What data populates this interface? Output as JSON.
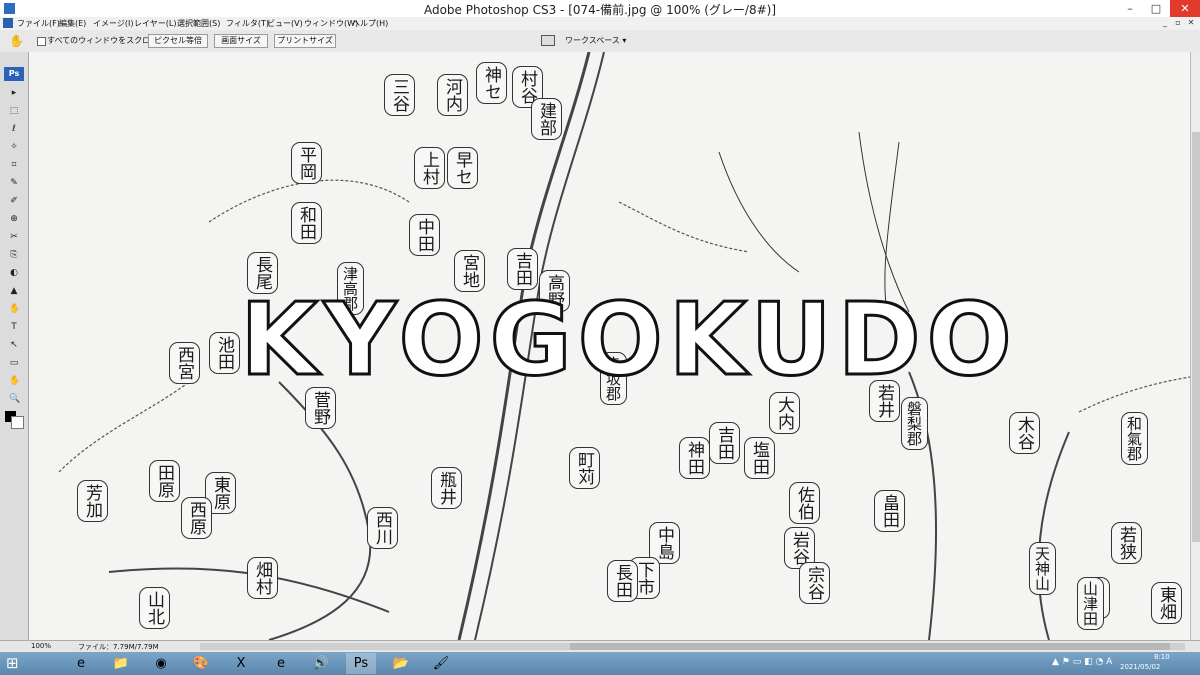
{
  "window": {
    "title": "Adobe Photoshop CS3 - [074-備前.jpg @ 100% (グレー/8#)]",
    "controls": {
      "minimize": "–",
      "maximize": "□",
      "close": "✕"
    }
  },
  "menu": {
    "items": [
      "ファイル(F)",
      "編集(E)",
      "イメージ(I)",
      "レイヤー(L)",
      "選択範囲(S)",
      "フィルタ(T)",
      "ビュー(V)",
      "ウィンドウ(W)",
      "ヘルプ(H)"
    ],
    "doc_controls": {
      "minimize": "_",
      "restore": "▫",
      "close": "✕"
    }
  },
  "options_bar": {
    "tool_icon": "hand-tool-icon",
    "scroll_all_windows_label": "すべてのウィンドウをスクロール",
    "scroll_all_windows_checked": false,
    "buttons": [
      "ピクセル等倍",
      "画面サイズ",
      "プリントサイズ"
    ],
    "workspace_label": "ワークスペース ▾"
  },
  "toolbox": {
    "logo": "Ps",
    "tool_glyphs": [
      "▸",
      "⬚",
      "ℓ",
      "✧",
      "⌗",
      "✎",
      "✐",
      "⊕",
      "✂",
      "⎘",
      "◐",
      "▲",
      "✋",
      "T",
      "↖",
      "▭",
      "✋",
      "🔍"
    ]
  },
  "canvas": {
    "watermark": "KYOGOKUDO",
    "map_labels": [
      {
        "text": "河内"
      },
      {
        "text": "三谷"
      },
      {
        "text": "神セ"
      },
      {
        "text": "村谷"
      },
      {
        "text": "建部"
      },
      {
        "text": "平岡"
      },
      {
        "text": "和田"
      },
      {
        "text": "長尾"
      },
      {
        "text": "津高郡"
      },
      {
        "text": "上村"
      },
      {
        "text": "早セ"
      },
      {
        "text": "中田"
      },
      {
        "text": "宮地"
      },
      {
        "text": "吉田"
      },
      {
        "text": "高野"
      },
      {
        "text": "池田"
      },
      {
        "text": "西宮"
      },
      {
        "text": "菅野"
      },
      {
        "text": "赤坂郡"
      },
      {
        "text": "磐梨郡"
      },
      {
        "text": "和氣郡"
      },
      {
        "text": "大内"
      },
      {
        "text": "東原"
      },
      {
        "text": "西原"
      },
      {
        "text": "芳加"
      },
      {
        "text": "田原"
      },
      {
        "text": "山北"
      },
      {
        "text": "畑村"
      },
      {
        "text": "西川"
      },
      {
        "text": "瓶井"
      },
      {
        "text": "神田"
      },
      {
        "text": "吉田"
      },
      {
        "text": "町苅"
      },
      {
        "text": "中島"
      },
      {
        "text": "下市"
      },
      {
        "text": "長田"
      },
      {
        "text": "若井"
      },
      {
        "text": "畠田"
      },
      {
        "text": "塩田"
      },
      {
        "text": "木谷"
      },
      {
        "text": "天神山"
      },
      {
        "text": "山口"
      },
      {
        "text": "佐伯"
      },
      {
        "text": "東畑"
      },
      {
        "text": "岩谷"
      },
      {
        "text": "若狭"
      },
      {
        "text": "山津田"
      },
      {
        "text": "宗谷"
      }
    ]
  },
  "status_bar": {
    "zoom": "100%",
    "doc_info": "ファイル：7.79M/7.79M"
  },
  "taskbar": {
    "start_icon": "windows-start-icon",
    "apps": [
      {
        "name": "ie-icon",
        "glyph": "e"
      },
      {
        "name": "explorer-icon",
        "glyph": "📁"
      },
      {
        "name": "chrome-icon",
        "glyph": "◉"
      },
      {
        "name": "paint-app-icon",
        "glyph": "🎨"
      },
      {
        "name": "excel-icon",
        "glyph": "X"
      },
      {
        "name": "edge-icon",
        "glyph": "e"
      },
      {
        "name": "speaker-app-icon",
        "glyph": "🔊"
      },
      {
        "name": "photoshop-icon",
        "glyph": "Ps"
      },
      {
        "name": "folder-icon",
        "glyph": "📂"
      },
      {
        "name": "paint-brush-icon",
        "glyph": "🖌"
      }
    ],
    "tray_glyphs": "▲ ⚑ ▭ ◧ ◔ A",
    "time": "8:10",
    "date": "2021/05/02"
  },
  "colors": {
    "titlebar_bg": "#ffffff",
    "close_button": "#e23b2e",
    "photoshop_blue": "#2c63b8",
    "taskbar": "#6f98bd",
    "canvas_paper": "#f4f4f2"
  }
}
